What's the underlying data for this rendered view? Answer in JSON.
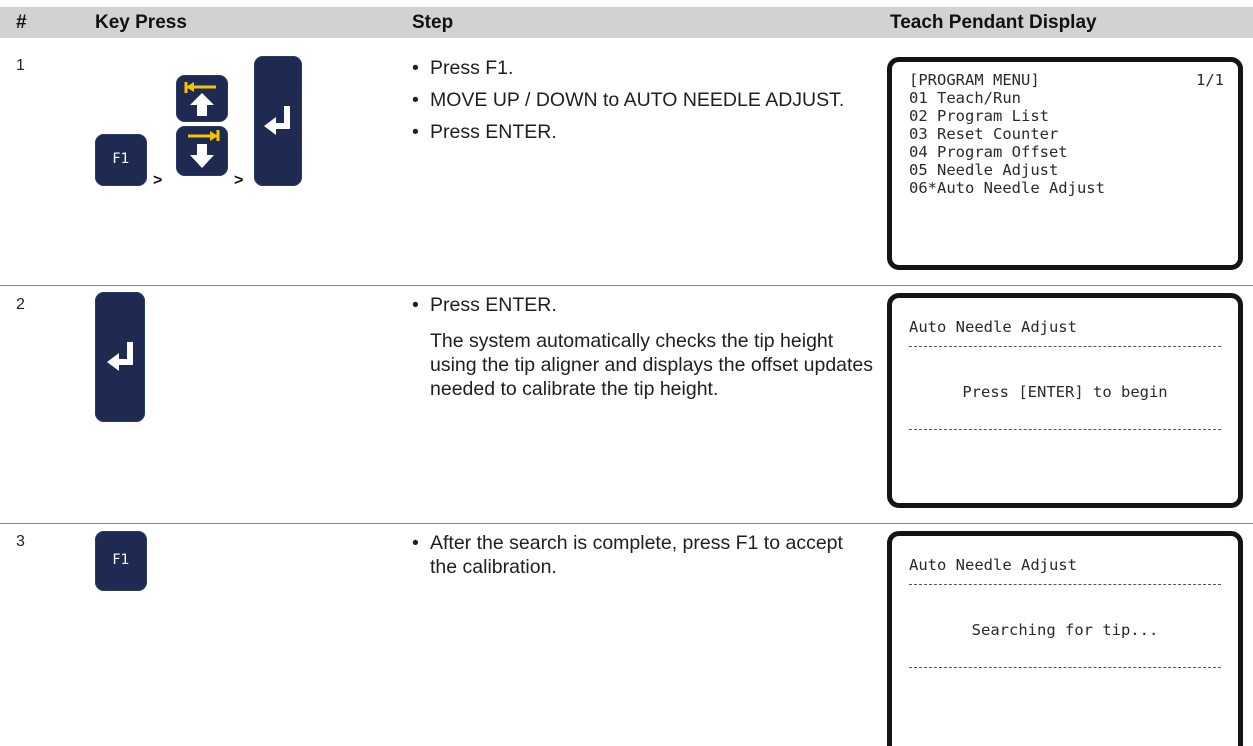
{
  "header": {
    "num": "#",
    "key_press": "Key Press",
    "step": "Step",
    "display": "Teach Pendant Display"
  },
  "rows": [
    {
      "num": "1",
      "keys": {
        "f1": "F1",
        "sep": ">"
      },
      "steps": [
        "Press F1.",
        "MOVE UP / DOWN to AUTO NEEDLE ADJUST.",
        "Press ENTER."
      ],
      "display": {
        "title": "[PROGRAM MENU]",
        "page": "1/1",
        "items": [
          "01 Teach/Run",
          "02 Program List",
          "03 Reset Counter",
          "04 Program Offset",
          "05 Needle Adjust",
          "06*Auto Needle Adjust"
        ]
      }
    },
    {
      "num": "2",
      "steps": [
        "Press ENTER."
      ],
      "paragraph": "The system automatically checks the tip height using the tip aligner and displays the offset updates needed to calibrate the tip height.",
      "display": {
        "title": "Auto Needle Adjust",
        "message": "Press [ENTER] to begin"
      }
    },
    {
      "num": "3",
      "keys": {
        "f1": "F1"
      },
      "steps": [
        "After the search is complete, press F1 to accept the calibration."
      ],
      "display": {
        "title": "Auto Needle Adjust",
        "message": "Searching for tip..."
      }
    }
  ],
  "colors": {
    "key_bg": "#1f2a52",
    "arrow_accent": "#f5c400",
    "header_bg": "#d1d2d3"
  }
}
